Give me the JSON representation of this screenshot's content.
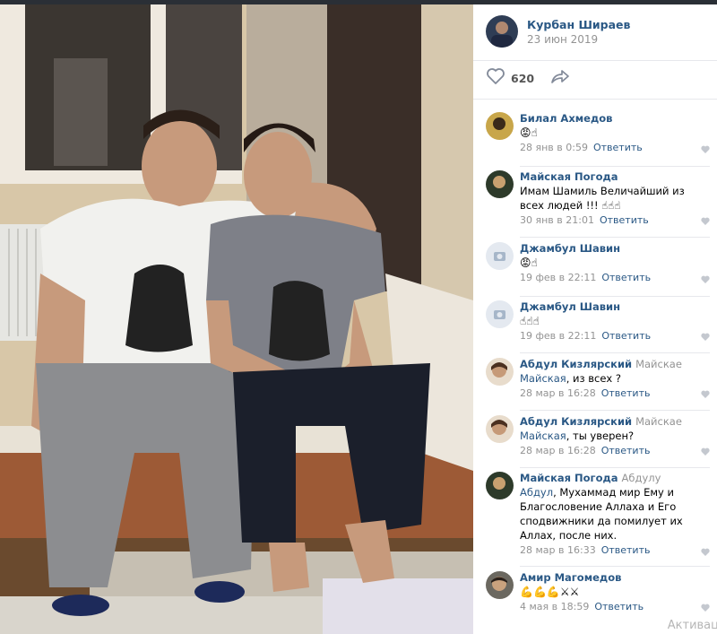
{
  "post": {
    "author_name": "Курбан Шираев",
    "date": "23 июн 2019",
    "likes": "620"
  },
  "comments": [
    {
      "name": "Билал Ахмедов",
      "reply_to": "",
      "text": "😡☝",
      "time": "28 янв в 0:59",
      "reply": "Ответить"
    },
    {
      "name": "Майская Погода",
      "reply_to": "",
      "text": "Имам Шамиль Величайший из всех людей !!! ☝☝☝",
      "time": "30 янв в 21:01",
      "reply": "Ответить"
    },
    {
      "name": "Джамбул Шавин",
      "reply_to": "",
      "text": "😡☝",
      "time": "19 фев в 22:11",
      "reply": "Ответить"
    },
    {
      "name": "Джамбул Шавин",
      "reply_to": "",
      "text": "☝☝☝",
      "time": "19 фев в 22:11",
      "reply": "Ответить"
    },
    {
      "name": "Абдул Кизлярский",
      "reply_to": "Майскае",
      "mention": "Майская",
      "text": ", из всех ?",
      "time": "28 мар в 16:28",
      "reply": "Ответить"
    },
    {
      "name": "Абдул Кизлярский",
      "reply_to": "Майскае",
      "mention": "Майская",
      "text": ", ты уверен?",
      "time": "28 мар в 16:28",
      "reply": "Ответить"
    },
    {
      "name": "Майская Погода",
      "reply_to": "Абдулу",
      "mention": "Абдул",
      "text": ", Мухаммад мир Ему и Благословение Аллаха и Его сподвижники да помилует их Аллах, после них.",
      "time": "28 мар в 16:33",
      "reply": "Ответить"
    },
    {
      "name": "Амир Магомедов",
      "reply_to": "",
      "text": "💪💪💪⚔⚔",
      "time": "4 мая в 18:59",
      "reply": "Ответить"
    }
  ],
  "overlay": {
    "activate": "Активац"
  },
  "colors": {
    "link": "#2a5885",
    "muted": "#939393"
  },
  "icons": {
    "like": "heart-icon",
    "share": "share-arrow-icon",
    "camera": "camera-icon"
  }
}
